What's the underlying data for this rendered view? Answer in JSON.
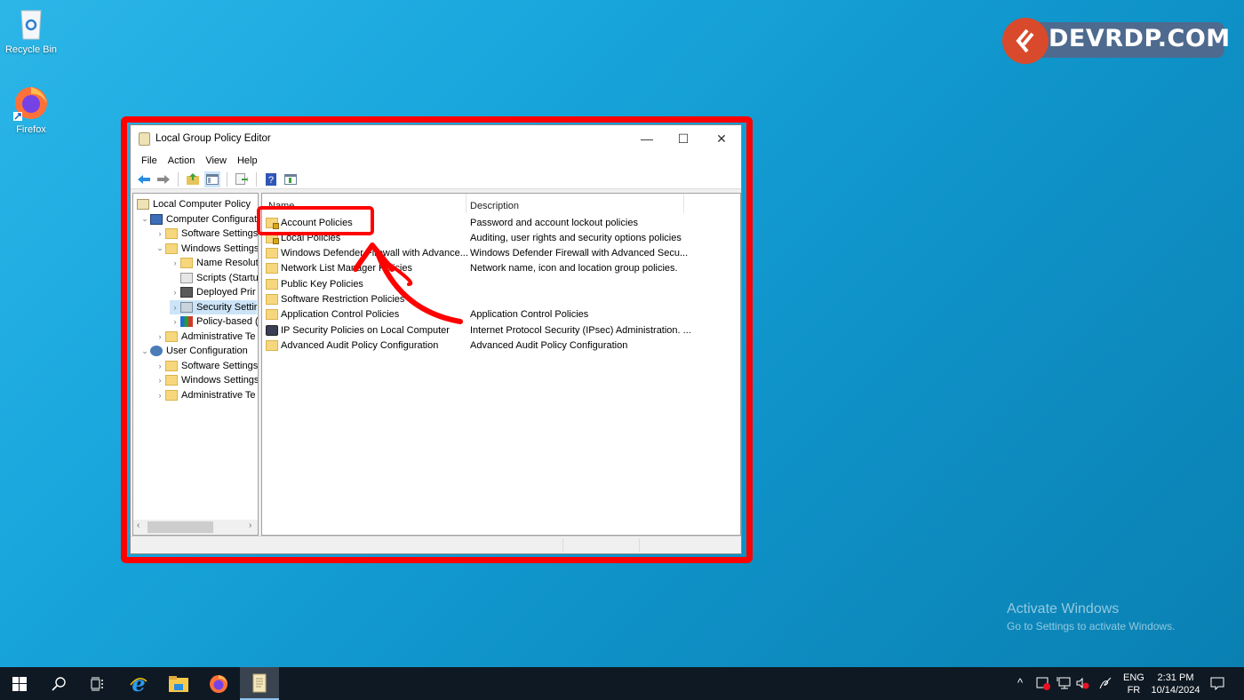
{
  "desktop": {
    "icons": [
      {
        "name": "recycle-bin",
        "label": "Recycle Bin"
      },
      {
        "name": "firefox",
        "label": "Firefox"
      }
    ],
    "watermark": "DEVRDP.COM",
    "activate": {
      "title": "Activate Windows",
      "subtitle": "Go to Settings to activate Windows."
    }
  },
  "window": {
    "title": "Local Group Policy Editor",
    "controls": {
      "minimize": "—",
      "maximize": "☐",
      "close": "✕"
    },
    "menu": [
      "File",
      "Action",
      "View",
      "Help"
    ],
    "toolbar": [
      "back-icon",
      "forward-icon",
      "up-folder-icon",
      "show-hide-tree-icon",
      "export-list-icon",
      "help-icon",
      "show-action-pane-icon"
    ],
    "tree": [
      {
        "label": "Local Computer Policy",
        "level": 0,
        "expander": "",
        "icon": "policy-scroll"
      },
      {
        "label": "Computer Configurat",
        "level": 1,
        "expander": "⌄",
        "icon": "computer"
      },
      {
        "label": "Software Settings",
        "level": 2,
        "expander": "›",
        "icon": "folder"
      },
      {
        "label": "Windows Settings",
        "level": 2,
        "expander": "⌄",
        "icon": "folder"
      },
      {
        "label": "Name Resolut",
        "level": 3,
        "expander": "›",
        "icon": "folder"
      },
      {
        "label": "Scripts (Startu",
        "level": 3,
        "expander": "",
        "icon": "script"
      },
      {
        "label": "Deployed Prir",
        "level": 3,
        "expander": "›",
        "icon": "printer"
      },
      {
        "label": "Security Settir",
        "level": 3,
        "expander": "›",
        "icon": "security",
        "selected": true
      },
      {
        "label": "Policy-based (",
        "level": 3,
        "expander": "›",
        "icon": "chart"
      },
      {
        "label": "Administrative Te",
        "level": 2,
        "expander": "›",
        "icon": "folder"
      },
      {
        "label": "User Configuration",
        "level": 1,
        "expander": "⌄",
        "icon": "user"
      },
      {
        "label": "Software Settings",
        "level": 2,
        "expander": "›",
        "icon": "folder"
      },
      {
        "label": "Windows Settings",
        "level": 2,
        "expander": "›",
        "icon": "folder"
      },
      {
        "label": "Administrative Te",
        "level": 2,
        "expander": "›",
        "icon": "folder"
      }
    ],
    "columns": {
      "name": "Name",
      "description": "Description"
    },
    "items": [
      {
        "name": "Account Policies",
        "description": "Password and account lockout policies",
        "icon": "folder-lock"
      },
      {
        "name": "Local Policies",
        "description": "Auditing, user rights and security options policies",
        "icon": "folder-lock"
      },
      {
        "name": "Windows Defender Firewall with Advance...",
        "description": "Windows Defender Firewall with Advanced Secu...",
        "icon": "folder"
      },
      {
        "name": "Network List Manager Policies",
        "description": "Network name, icon and location group policies.",
        "icon": "folder"
      },
      {
        "name": "Public Key Policies",
        "description": "",
        "icon": "folder"
      },
      {
        "name": "Software Restriction Policies",
        "description": "",
        "icon": "folder"
      },
      {
        "name": "Application Control Policies",
        "description": "Application Control Policies",
        "icon": "folder"
      },
      {
        "name": "IP Security Policies on Local Computer",
        "description": "Internet Protocol Security (IPsec) Administration. ...",
        "icon": "ipsec"
      },
      {
        "name": "Advanced Audit Policy Configuration",
        "description": "Advanced Audit Policy Configuration",
        "icon": "folder"
      }
    ]
  },
  "taskbar": {
    "buttons": [
      "start",
      "search",
      "task-view",
      "internet-explorer",
      "file-explorer",
      "firefox",
      "group-policy-editor"
    ],
    "tray": {
      "lang_top": "ENG",
      "lang_bottom": "FR",
      "time": "2:31 PM",
      "date": "10/14/2024"
    }
  }
}
